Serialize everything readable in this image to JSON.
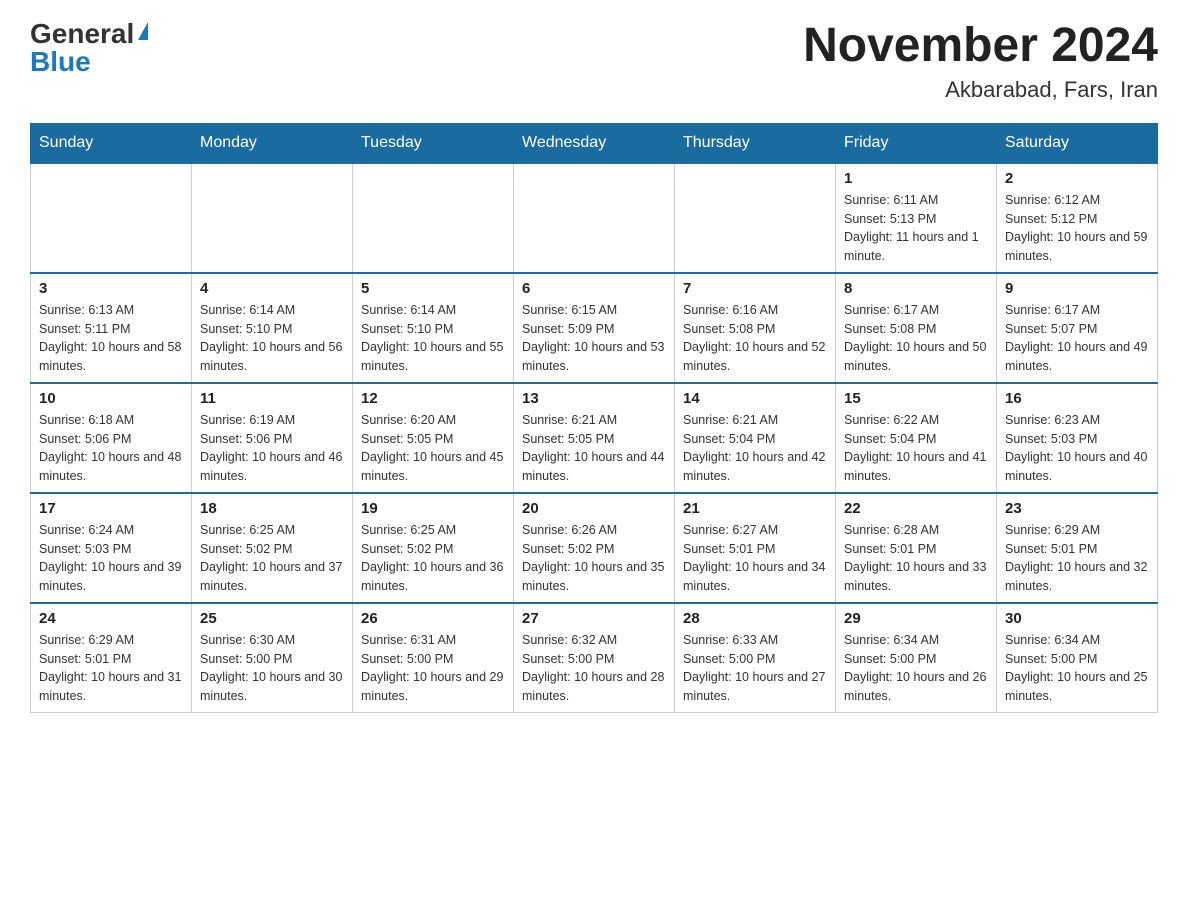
{
  "logo": {
    "general": "General",
    "blue": "Blue"
  },
  "title": "November 2024",
  "subtitle": "Akbarabad, Fars, Iran",
  "weekdays": [
    "Sunday",
    "Monday",
    "Tuesday",
    "Wednesday",
    "Thursday",
    "Friday",
    "Saturday"
  ],
  "weeks": [
    [
      {
        "day": "",
        "info": ""
      },
      {
        "day": "",
        "info": ""
      },
      {
        "day": "",
        "info": ""
      },
      {
        "day": "",
        "info": ""
      },
      {
        "day": "",
        "info": ""
      },
      {
        "day": "1",
        "info": "Sunrise: 6:11 AM\nSunset: 5:13 PM\nDaylight: 11 hours and 1 minute."
      },
      {
        "day": "2",
        "info": "Sunrise: 6:12 AM\nSunset: 5:12 PM\nDaylight: 10 hours and 59 minutes."
      }
    ],
    [
      {
        "day": "3",
        "info": "Sunrise: 6:13 AM\nSunset: 5:11 PM\nDaylight: 10 hours and 58 minutes."
      },
      {
        "day": "4",
        "info": "Sunrise: 6:14 AM\nSunset: 5:10 PM\nDaylight: 10 hours and 56 minutes."
      },
      {
        "day": "5",
        "info": "Sunrise: 6:14 AM\nSunset: 5:10 PM\nDaylight: 10 hours and 55 minutes."
      },
      {
        "day": "6",
        "info": "Sunrise: 6:15 AM\nSunset: 5:09 PM\nDaylight: 10 hours and 53 minutes."
      },
      {
        "day": "7",
        "info": "Sunrise: 6:16 AM\nSunset: 5:08 PM\nDaylight: 10 hours and 52 minutes."
      },
      {
        "day": "8",
        "info": "Sunrise: 6:17 AM\nSunset: 5:08 PM\nDaylight: 10 hours and 50 minutes."
      },
      {
        "day": "9",
        "info": "Sunrise: 6:17 AM\nSunset: 5:07 PM\nDaylight: 10 hours and 49 minutes."
      }
    ],
    [
      {
        "day": "10",
        "info": "Sunrise: 6:18 AM\nSunset: 5:06 PM\nDaylight: 10 hours and 48 minutes."
      },
      {
        "day": "11",
        "info": "Sunrise: 6:19 AM\nSunset: 5:06 PM\nDaylight: 10 hours and 46 minutes."
      },
      {
        "day": "12",
        "info": "Sunrise: 6:20 AM\nSunset: 5:05 PM\nDaylight: 10 hours and 45 minutes."
      },
      {
        "day": "13",
        "info": "Sunrise: 6:21 AM\nSunset: 5:05 PM\nDaylight: 10 hours and 44 minutes."
      },
      {
        "day": "14",
        "info": "Sunrise: 6:21 AM\nSunset: 5:04 PM\nDaylight: 10 hours and 42 minutes."
      },
      {
        "day": "15",
        "info": "Sunrise: 6:22 AM\nSunset: 5:04 PM\nDaylight: 10 hours and 41 minutes."
      },
      {
        "day": "16",
        "info": "Sunrise: 6:23 AM\nSunset: 5:03 PM\nDaylight: 10 hours and 40 minutes."
      }
    ],
    [
      {
        "day": "17",
        "info": "Sunrise: 6:24 AM\nSunset: 5:03 PM\nDaylight: 10 hours and 39 minutes."
      },
      {
        "day": "18",
        "info": "Sunrise: 6:25 AM\nSunset: 5:02 PM\nDaylight: 10 hours and 37 minutes."
      },
      {
        "day": "19",
        "info": "Sunrise: 6:25 AM\nSunset: 5:02 PM\nDaylight: 10 hours and 36 minutes."
      },
      {
        "day": "20",
        "info": "Sunrise: 6:26 AM\nSunset: 5:02 PM\nDaylight: 10 hours and 35 minutes."
      },
      {
        "day": "21",
        "info": "Sunrise: 6:27 AM\nSunset: 5:01 PM\nDaylight: 10 hours and 34 minutes."
      },
      {
        "day": "22",
        "info": "Sunrise: 6:28 AM\nSunset: 5:01 PM\nDaylight: 10 hours and 33 minutes."
      },
      {
        "day": "23",
        "info": "Sunrise: 6:29 AM\nSunset: 5:01 PM\nDaylight: 10 hours and 32 minutes."
      }
    ],
    [
      {
        "day": "24",
        "info": "Sunrise: 6:29 AM\nSunset: 5:01 PM\nDaylight: 10 hours and 31 minutes."
      },
      {
        "day": "25",
        "info": "Sunrise: 6:30 AM\nSunset: 5:00 PM\nDaylight: 10 hours and 30 minutes."
      },
      {
        "day": "26",
        "info": "Sunrise: 6:31 AM\nSunset: 5:00 PM\nDaylight: 10 hours and 29 minutes."
      },
      {
        "day": "27",
        "info": "Sunrise: 6:32 AM\nSunset: 5:00 PM\nDaylight: 10 hours and 28 minutes."
      },
      {
        "day": "28",
        "info": "Sunrise: 6:33 AM\nSunset: 5:00 PM\nDaylight: 10 hours and 27 minutes."
      },
      {
        "day": "29",
        "info": "Sunrise: 6:34 AM\nSunset: 5:00 PM\nDaylight: 10 hours and 26 minutes."
      },
      {
        "day": "30",
        "info": "Sunrise: 6:34 AM\nSunset: 5:00 PM\nDaylight: 10 hours and 25 minutes."
      }
    ]
  ]
}
